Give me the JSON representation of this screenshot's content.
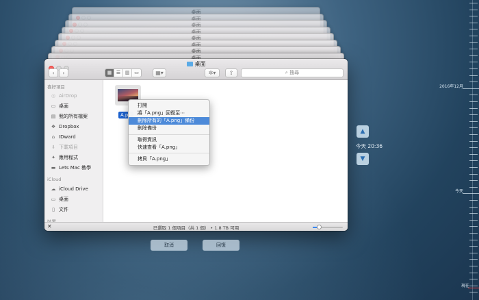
{
  "stack_windows": [
    {
      "title": "桌面"
    },
    {
      "title": "桌面"
    },
    {
      "title": "桌面"
    },
    {
      "title": "桌面"
    },
    {
      "title": "桌面"
    },
    {
      "title": "桌面"
    },
    {
      "title": "桌面"
    },
    {
      "title": "桌面"
    }
  ],
  "window": {
    "title": "桌面",
    "search_placeholder": "搜尋",
    "view_icons": [
      "icon-view-icon",
      "list-view-icon",
      "column-view-icon",
      "coverflow-view-icon"
    ]
  },
  "sidebar": {
    "favorites_header": "喜好項目",
    "favorites": [
      {
        "label": "AirDrop",
        "icon": "airdrop-icon",
        "dim": true
      },
      {
        "label": "桌面",
        "icon": "desktop-icon",
        "dim": false
      },
      {
        "label": "我的所有檔案",
        "icon": "all-files-icon",
        "dim": false
      },
      {
        "label": "Dropbox",
        "icon": "dropbox-icon",
        "dim": false
      },
      {
        "label": "IDward",
        "icon": "home-icon",
        "dim": false
      },
      {
        "label": "下載項目",
        "icon": "downloads-icon",
        "dim": true
      },
      {
        "label": "應用程式",
        "icon": "applications-icon",
        "dim": false
      },
      {
        "label": "Lets Mac 教學",
        "icon": "folder-icon",
        "dim": false
      }
    ],
    "icloud_header": "iCloud",
    "icloud": [
      {
        "label": "iCloud Drive",
        "icon": "cloud-icon",
        "dim": false
      },
      {
        "label": "桌面",
        "icon": "desktop-icon",
        "dim": false
      },
      {
        "label": "文件",
        "icon": "documents-icon",
        "dim": false
      }
    ],
    "devices_header": "裝置"
  },
  "file": {
    "name": "A.png",
    "label_visible": "A.pn"
  },
  "context_menu": {
    "items": [
      {
        "label": "打開",
        "highlighted": false
      },
      {
        "label": "將「A.png」回復至⋯",
        "highlighted": false
      },
      {
        "label": "刪除所有的「A.png」備份",
        "highlighted": true
      },
      {
        "label": "刪除備份",
        "highlighted": false
      },
      {
        "label": "取得資訊",
        "highlighted": false
      },
      {
        "label": "快速查看「A.png」",
        "highlighted": false
      },
      {
        "label": "拷貝「A.png」",
        "highlighted": false
      }
    ]
  },
  "status": {
    "text": "已選取 1 個項目（共 1 個） • 1.8 TB 可用",
    "zoom": 0.2
  },
  "buttons": {
    "cancel": "取消",
    "restore": "回復"
  },
  "nav": {
    "time": "今天 20:36"
  },
  "timeline": {
    "labels": [
      "2016年12月",
      "今天",
      "現在"
    ]
  },
  "colors": {
    "highlight": "#4d8ad9",
    "selection": "#1d62cf",
    "close": "#fc605c"
  }
}
